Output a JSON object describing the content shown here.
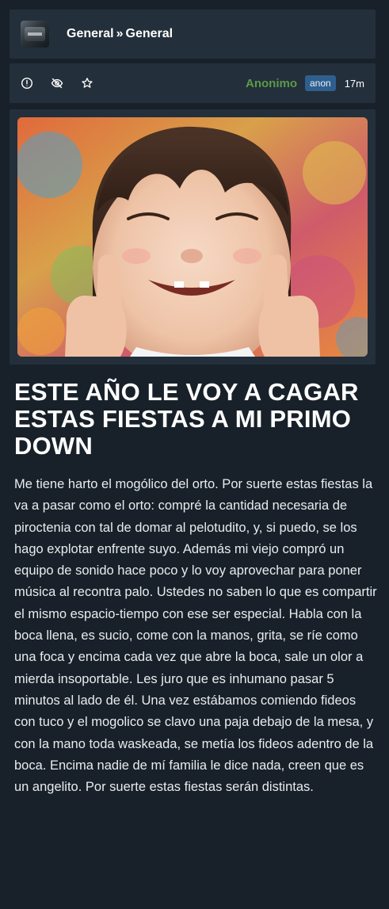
{
  "breadcrumb": {
    "category": "General",
    "separator": "»",
    "subcategory": "General"
  },
  "icons": {
    "category_thumb": "category-thumbnail",
    "report": "alert-circle-icon",
    "hide": "eye-off-icon",
    "favorite": "star-icon"
  },
  "post": {
    "author": "Anonimo",
    "badge": "anon",
    "time": "17m",
    "image_alt": "Niña sonriendo con los pulgares arriba",
    "title": "ESTE AÑO LE VOY A CAGAR ESTAS FIESTAS A MI PRIMO DOWN",
    "body": "Me tiene harto el mogólico del orto. Por suerte estas fiestas la va a pasar como el orto: compré la cantidad necesaria de piroctenia con tal de domar al pelotudito, y, si puedo, se los hago explotar enfrente suyo. Además mi viejo compró un equipo de sonido hace poco y lo voy aprovechar para poner música al recontra palo. Ustedes no saben lo que es compartir el mismo espacio-tiempo con ese ser especial. Habla con la boca llena, es sucio, come con la manos, grita, se ríe como una foca y encima cada vez que abre la boca, sale un olor a mierda insoportable. Les juro que es inhumano pasar 5 minutos al lado de él. Una vez estábamos comiendo fideos con tuco y el mogolico se clavo una paja debajo de la mesa, y con la mano toda waskeada, se metía los fideos adentro de la boca. Encima nadie de mí familia le dice nada, creen que es un angelito. Por suerte estas fiestas serán distintas."
  },
  "colors": {
    "background": "#182129",
    "panel": "#232f3b",
    "author": "#5d9a48",
    "badge": "#2f5f8e",
    "text": "#e8ecef"
  }
}
